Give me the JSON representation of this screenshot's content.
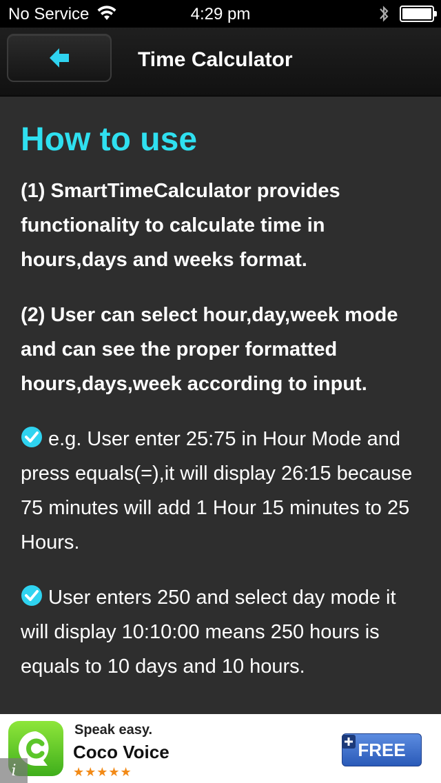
{
  "status_bar": {
    "carrier": "No Service",
    "time": "4:29 pm"
  },
  "nav": {
    "title": "Time Calculator",
    "back_icon": "arrow-left-icon"
  },
  "content": {
    "heading": "How to use",
    "paragraph1": "(1) SmartTimeCalculator provides functionality to calculate time in hours,days and weeks format.",
    "paragraph2": "(2) User can select hour,day,week mode and can see the proper formatted hours,days,week according to input.",
    "example1": "e.g. User enter 25:75 in Hour Mode and press equals(=),it will display 26:15 because 75 minutes will add 1 Hour 15 minutes to 25 Hours.",
    "example2": "User enters 250 and select day mode it will display 10:10:00 means 250 hours is equals to 10 days and 10 hours."
  },
  "ad": {
    "tagline": "Speak easy.",
    "app_name": "Coco Voice",
    "stars": "★★★★★",
    "button_label": "FREE"
  },
  "colors": {
    "accent": "#2fe0f0",
    "background": "#2e2e2e",
    "nav_background": "#151515"
  }
}
